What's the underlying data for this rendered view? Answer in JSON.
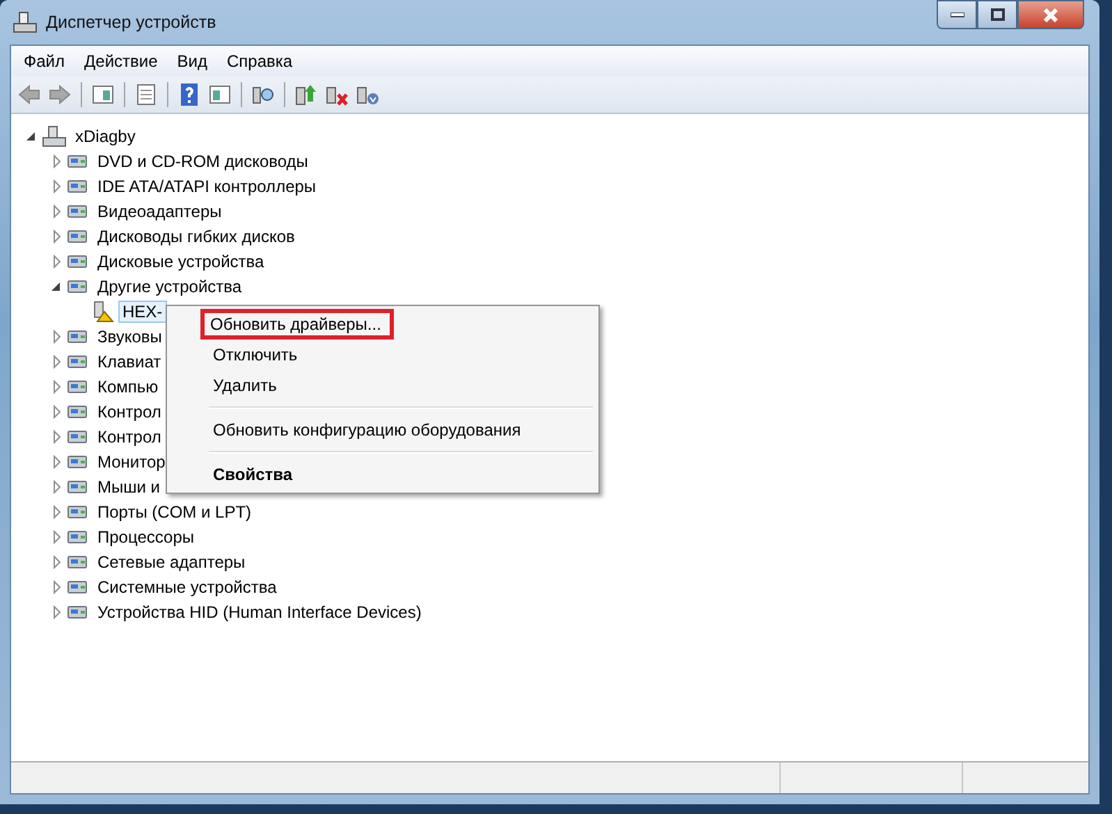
{
  "window": {
    "title": "Диспетчер устройств"
  },
  "menu_bar": [
    "Файл",
    "Действие",
    "Вид",
    "Справка"
  ],
  "tree": {
    "label": "xDiagby",
    "expanded": true,
    "children": [
      {
        "label": "DVD и CD-ROM дисководы",
        "expanded": false
      },
      {
        "label": "IDE ATA/ATAPI контроллеры",
        "expanded": false
      },
      {
        "label": "Видеоадаптеры",
        "expanded": false
      },
      {
        "label": "Дисководы гибких дисков",
        "expanded": false
      },
      {
        "label": "Дисковые устройства",
        "expanded": false
      },
      {
        "label": "Другие устройства",
        "expanded": true,
        "children": [
          {
            "label": "HEX-",
            "warning": true,
            "selected": true
          }
        ]
      },
      {
        "label": "Звуковы",
        "expanded": false
      },
      {
        "label": "Клавиат",
        "expanded": false
      },
      {
        "label": "Компью",
        "expanded": false
      },
      {
        "label": "Контрол",
        "expanded": false
      },
      {
        "label": "Контрол",
        "expanded": false
      },
      {
        "label": "Монитор",
        "expanded": false
      },
      {
        "label": "Мыши и",
        "expanded": false
      },
      {
        "label": "Порты (COM и LPT)",
        "expanded": false
      },
      {
        "label": "Процессоры",
        "expanded": false
      },
      {
        "label": "Сетевые адаптеры",
        "expanded": false
      },
      {
        "label": "Системные устройства",
        "expanded": false
      },
      {
        "label": "Устройства HID (Human Interface Devices)",
        "expanded": false
      }
    ]
  },
  "context_menu": [
    {
      "kind": "item",
      "label": "Обновить драйверы...",
      "highlighted": true,
      "bold": false
    },
    {
      "kind": "item",
      "label": "Отключить",
      "highlighted": false,
      "bold": false
    },
    {
      "kind": "item",
      "label": "Удалить",
      "highlighted": false,
      "bold": false
    },
    {
      "kind": "separator"
    },
    {
      "kind": "item",
      "label": "Обновить конфигурацию оборудования",
      "highlighted": false,
      "bold": false
    },
    {
      "kind": "separator"
    },
    {
      "kind": "item",
      "label": "Свойства",
      "highlighted": false,
      "bold": true
    }
  ]
}
